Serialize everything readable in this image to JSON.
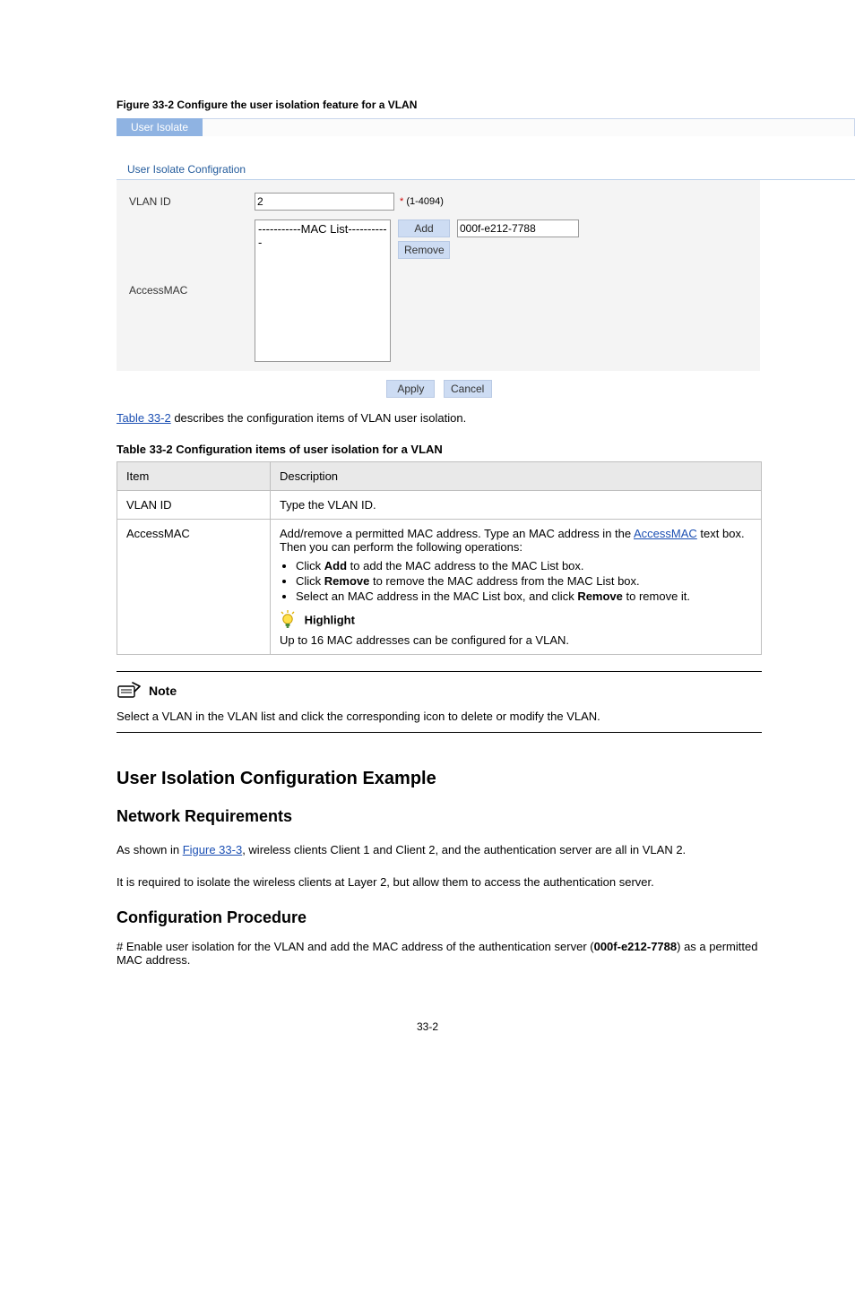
{
  "figure": {
    "caption": "Figure 33-2 Configure the user isolation feature for a VLAN",
    "tab_label": "User Isolate",
    "form_title": "User Isolate Configration",
    "vlan_label": "VLAN ID",
    "vlan_value": "2",
    "vlan_hint_star": "*",
    "vlan_hint_range": " (1-4094)",
    "accessmac_label": "AccessMAC",
    "maclist_placeholder": "-----------MAC List-----------",
    "add_btn": "Add",
    "remove_btn": "Remove",
    "mac_input_value": "000f-e212-7788",
    "apply_btn": "Apply",
    "cancel_btn": "Cancel"
  },
  "after_fig_text": {
    "ref_link": "Table 33-2",
    "after": " describes the configuration items of VLAN user isolation."
  },
  "table": {
    "title": "Table 33-2 Configuration items of user isolation for a VLAN",
    "col_item": "Item",
    "col_desc": "Description",
    "r1_item": "VLAN ID",
    "r1_desc": "Type the VLAN ID.",
    "r2_item": "AccessMAC",
    "r2_desc_line1_before": "Add/remove a permitted MAC address. Type an MAC address in the ",
    "r2_desc_line1_link": "AccessMAC",
    "r2_desc_line1_after": " text box. Then you can perform the following operations:",
    "r2_li1_before": "Click ",
    "r2_li1_b": "Add",
    "r2_li1_after": " to add the MAC address to the MAC List box.",
    "r2_li2_before": "Click ",
    "r2_li2_b": "Remove",
    "r2_li2_after": " to remove the MAC address from the MAC List box.",
    "r2_li3_before": "Select an MAC address in the MAC List box, and click ",
    "r2_li3_b": "Remove",
    "r2_li3_after": " to remove it.",
    "hl_label": "Highlight",
    "hl_text": "Up to 16 MAC addresses can be configured for a VLAN."
  },
  "note": {
    "label": "Note",
    "text": "Select a VLAN in the VLAN list and click the corresponding icon to delete or modify the VLAN."
  },
  "section": {
    "title": "User Isolation Configuration Example",
    "req_title": "Network Requirements",
    "req_p1": "As shown in ",
    "req_link": "Figure 33-3",
    "req_p2": ", wireless clients Client 1 and Client 2, and the authentication server are all in VLAN 2.",
    "req_p3": "It is required to isolate the wireless clients at Layer 2, but allow them to access the authentication server.",
    "cfg_title": "Configuration Procedure",
    "step1_before": "# Enable user isolation for the VLAN and add the MAC address of the authentication server (",
    "step1_mac": "000f-e212-7788",
    "step1_after": ") as a permitted MAC address."
  },
  "page_number": "33-2"
}
